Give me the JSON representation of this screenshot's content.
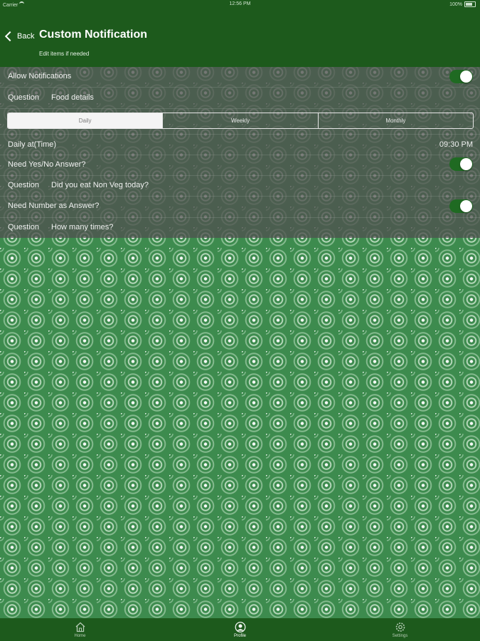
{
  "status_bar": {
    "carrier": "Carrier",
    "time": "12:56 PM",
    "battery": "100%"
  },
  "navbar": {
    "back_label": "Back",
    "title": "Custom Notification",
    "subtitle": "Edit items if needed"
  },
  "form": {
    "allow_notifications": {
      "label": "Allow Notifications",
      "on": true
    },
    "question1": {
      "label": "Question",
      "value": "Food details"
    },
    "frequency": {
      "options": [
        "Daily",
        "Weekly",
        "Monthly"
      ],
      "selected": "Daily"
    },
    "daily_time": {
      "label": "Daily at(Time)",
      "value": "09:30 PM"
    },
    "need_yes_no": {
      "label": "Need Yes/No Answer?",
      "on": true
    },
    "question2": {
      "label": "Question",
      "value": "Did you eat Non Veg today?"
    },
    "need_number": {
      "label": "Need Number as Answer?",
      "on": true
    },
    "question3": {
      "label": "Question",
      "value": "How many times?"
    }
  },
  "tabbar": {
    "tabs": [
      {
        "label": "Home",
        "icon": "home-icon",
        "active": false
      },
      {
        "label": "Profile",
        "icon": "profile-icon",
        "active": true
      },
      {
        "label": "Settings",
        "icon": "settings-icon",
        "active": false
      }
    ]
  },
  "colors": {
    "header": "#1d5a1c",
    "background": "#3d8b4e",
    "toggle_on": "#1f6a22"
  }
}
